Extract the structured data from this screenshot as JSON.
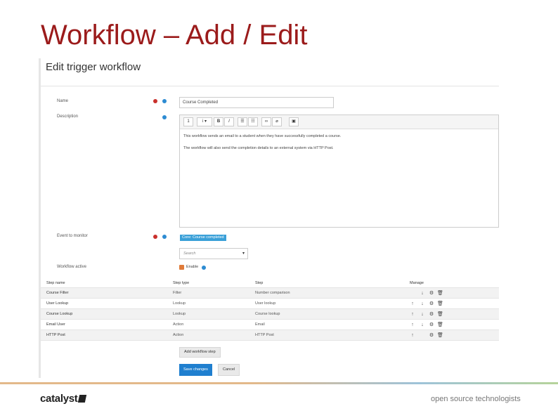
{
  "slide": {
    "title": "Workflow – Add / Edit"
  },
  "form": {
    "heading": "Edit trigger workflow",
    "name_label": "Name",
    "name_value": "Course Completed",
    "description_label": "Description",
    "description_lines": [
      "This workflow sends an email to a student when they have successfully completed a course.",
      "The workflow will also send the completion details to an external system via HTTP Post."
    ],
    "toolbar": {
      "format": "1",
      "info": "i ▾",
      "bold": "B",
      "italic": "I"
    },
    "event_label": "Event to monitor",
    "event_value": "Core: Course completed",
    "search_placeholder": "Search",
    "active_label": "Workflow active",
    "enable_label": "Enable",
    "enable_checked": true
  },
  "steps_table": {
    "headers": [
      "Step name",
      "Step type",
      "Step",
      "Manage"
    ],
    "rows": [
      {
        "name": "Course Filter",
        "type": "Filter",
        "step": "Number comparison",
        "manage": [
          "down",
          "gear",
          "trash"
        ]
      },
      {
        "name": "User Lookup",
        "type": "Lookup",
        "step": "User lookup",
        "manage": [
          "up",
          "down",
          "gear",
          "trash"
        ]
      },
      {
        "name": "Course Lookup",
        "type": "Lookup",
        "step": "Course lookup",
        "manage": [
          "up",
          "down",
          "gear",
          "trash"
        ]
      },
      {
        "name": "Email User",
        "type": "Action",
        "step": "Email",
        "manage": [
          "up",
          "down",
          "gear",
          "trash"
        ]
      },
      {
        "name": "HTTP Post",
        "type": "Action",
        "step": "HTTP Post",
        "manage": [
          "up",
          "gear",
          "trash"
        ]
      }
    ]
  },
  "buttons": {
    "add_step": "Add workflow step",
    "save": "Save changes",
    "cancel": "Cancel"
  },
  "footer": {
    "logo": "catalyst",
    "tagline": "open source technologists"
  },
  "colors": {
    "title": "#9b1b1b",
    "primary": "#1f7fcf",
    "badge": "#3aa0d8",
    "required": "#c9302c",
    "checkbox": "#e07b39"
  }
}
